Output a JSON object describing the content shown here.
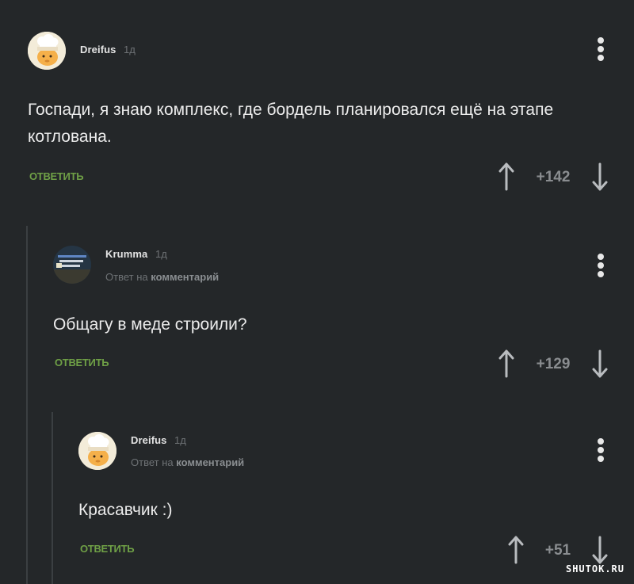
{
  "comments": [
    {
      "author": "Dreifus",
      "time": "1д",
      "text_line1": "Госпади, я знаю комплекс, где бордель планировался ещё на этапе",
      "text_line2": "котлована.",
      "reply_label": "ОТВЕТИТЬ",
      "score": "+142"
    },
    {
      "author": "Krumma",
      "time": "1д",
      "reply_prefix": "Ответ на",
      "reply_target": "комментарий",
      "text": "Общагу в меде строили?",
      "reply_label": "ОТВЕТИТЬ",
      "score": "+129"
    },
    {
      "author": "Dreifus",
      "time": "1д",
      "reply_prefix": "Ответ на",
      "reply_target": "комментарий",
      "text": "Красавчик :)",
      "reply_label": "ОТВЕТИТЬ",
      "score": "+51"
    }
  ],
  "watermark": "SHUTOK.RU",
  "colors": {
    "background": "#242729",
    "reply_green": "#6fa046",
    "muted": "#6e7275",
    "thread_line": "#3b3f42"
  }
}
